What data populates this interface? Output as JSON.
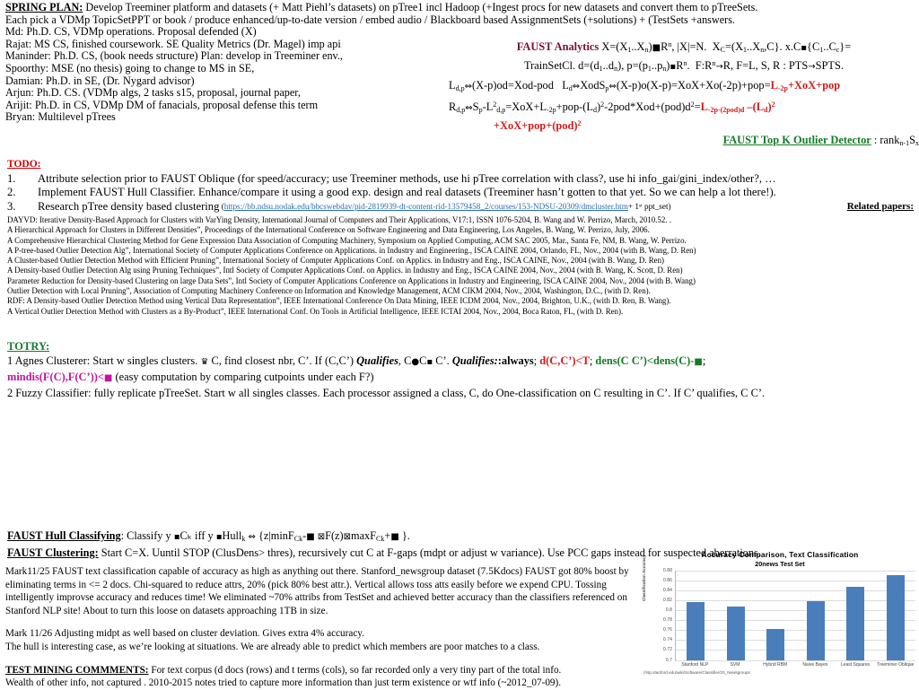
{
  "plan": {
    "heading": "SPRING PLAN:",
    "heading_rest": " Develop Treeminer platform and datasets (+ Matt Piehl’s datasets) on pTree1 incl Hadoop (+Ingest procs for new datasets and convert them to pTreeSets.",
    "lines": [
      "Each pick a VDMp TopicSetPPT or book / produce enhanced/up-to-date version / embed audio / Blackboard based AssignmentSets (+solutions) + (TestSets +answers.",
      "Md:  Ph.D. CS, VDMp operations.  Proposal defended (X)",
      "Rajat: MS CS, finished coursework. SE Quality Metrics (Dr. Magel) imp api",
      "Maninder: Ph.D. CS, (book needs structure)  Plan: develop in Treeminer env.,",
      "Spoorthy: MSE (no thesis) going to change to MS in SE,",
      "Damian: Ph.D. in SE, (Dr. Nygard advisor)",
      "Arjun:  Ph.D. CS. (VDMp algs, 2 tasks s15, proposal, journal paper,",
      "Arijit: Ph.D. in CS, VDMp DM of fanacials, proposal defense this term",
      "Bryan:  Multilevel pTrees"
    ]
  },
  "analytics": {
    "title": "FAUST Analytics",
    "line1_a": "X=(X",
    "line1_b": "..X",
    "line1_c": ")",
    "line1_d": "R",
    "line1_e": ", |X|=N.  X",
    "line1_f": "=(X",
    "line1_g": "..X",
    "line1_h": ",C}. x.C",
    "line1_i": "{C",
    "line1_j": "..C",
    "line1_k": "}=",
    "line2": "TrainSetCl. d=(d₁..dₙ), p=(p₁..pₙ)  Rⁿ.   F:Rⁿ  R, F=L, S, R : PTS  SPTS.",
    "line3_black": "Lₔ,ₚ  ⇔(X-p)od=Xod-pod   Lₔ ⇔XodSₚ ⇔(X-p)o(X-p)=XoX+Xo(-2p)+pop=",
    "line3_red": "L₋₂ₚ+XoX+pop",
    "line4_black": "Rₔ,ₚ ⇔Sₚ-L²ₔ,ₚ =XoX+L₋₂ₚ+pop-(Lₔ)²-2pod*Xod+(pod)d²=",
    "line4_red": "L₋₂ₚ₋₍₂ₚₒₔ₎ₔ –(Lₔ)²",
    "line5_red": "+XoX+pop+(pod)²",
    "topk_title": "FAUST Top K Outlier Detector",
    "topk_rest": " : rankₙ₋₁Sₓ"
  },
  "todo": {
    "header": "TODO:",
    "items": [
      {
        "num": "1.",
        "text": "Attribute selection prior to FAUST Oblique (for speed/accuracy; use Treeminer methods, use hi pTree correlation with class?,  use hi info_gai/gini_index/other?, …"
      },
      {
        "num": "2.",
        "text": "Implement FAUST Hull Classifier.  Enhance/compare it using a good exp. design and real datasets (Treeminer hasn’t gotten to that yet.  So we can help  a lot there!)."
      },
      {
        "num": "3.",
        "text": "Research pTree density based clustering"
      }
    ],
    "item3_link": "https://bb.ndsu.nodak.edu/bbcswebdav/pid-2819939-dt-content-rid-13579458_2/courses/153-NDSU-20309/dmcluster.htm",
    "item3_tail": " + 1ˢᵗ ppt_set)",
    "related_papers": "Related papers:"
  },
  "references": [
    "DAYVD: Iterative Density-Based Approach for Clusters with VarYing Density, International Journal of Computers and Their Applications, V17:1, ISSN 1076-5204, B. Wang and W. Perrizo, March, 2010.52. .",
    "A Hierarchical Approach for Clusters in Different Densities”, Proceedings of the International Conference on Software Engineering and Data Engineering, Los Angeles, B. Wang, W. Perrizo, July, 2006.",
    "A Comprehensive Hierarchical Clustering Method for Gene Expression Data Association of Computing Machinery, Symposium on Applied Computing, ACM SAC 2005, Mar., Santa Fe, NM, B. Wang, W. Perrizo.",
    "A P-tree-based Outlier Detection Alg”, International Society of Computer Applications Conference on Applications. in Industry and Engineering., ISCA CAINE 2004, Orlando, FL, Nov., 2004 (with B. Wang, D. Ren)",
    "A Cluster-based Outlier Detection Method with Efficient Pruning”, International Society of Computer Applications Conf. on Applics. in Industry and Eng., ISCA CAINE, Nov., 2004 (with B. Wang, D. Ren)",
    "A Density-based Outlier Detection Alg using Pruning Techniques”, Intl Society of Computer Applications Conf. on Applics. in Industry and Eng., ISCA CAINE 2004, Nov., 2004 (with B. Wang, K. Scott, D. Ren)",
    "Parameter Reduction for Density-based Clustering on large Data Sets”, Intl Society of Computer Applications Conference on Applications in Industry and Engineering, ISCA CAINE 2004, Nov., 2004 (with B. Wang)",
    "Outlier Detection with Local Pruning”, Association of Computing Machinery Conference on Information and Knowledge Management, ACM CIKM 2004, Nov., 2004, Washington, D.C., (with D. Ren).",
    "RDF: A Density-based Outlier Detection Method using Vertical Data Representation”, IEEE International Conference On Data Mining, IEEE ICDM 2004, Nov., 2004, Brighton, U.K., (with D. Ren, B. Wang).",
    "A Vertical Outlier Detection Method with Clusters as a By-Product”, IEEE International Conf. On Tools in Artificial Intelligence, IEEE ICTAI 2004, Nov., 2004, Boca Raton, FL, (with D. Ren)."
  ],
  "totry": {
    "header": "TOTRY:",
    "line1_a": "1 Agnes Clusterer: Start w singles clusters. ",
    "line1_b": " C, find closest nbr, C’.  If (C,C’) ",
    "line1_qualifies": "Qualifies",
    "line1_c": ", C",
    "line1_d": "C",
    "line1_e": " C’.  ",
    "line1_qualifies2": "Qualifies:",
    "line1_f": ":always",
    "line1_sep1": "; ",
    "line1_red": "d(C,C’)<T",
    "line1_sep2": "; ",
    "line1_green": "dens(C    C’)<dens(C)-",
    "line1_tail": ";",
    "line2_magenta": "min₝dis(F(C),F(C’))<",
    "line2_rest": " (easy computation by comparing cutpoints under each F?)",
    "line3": "2 Fuzzy Classifier: fully replicate pTreeSet.  Start w all singles classes.  Each processor assigned a class, C, do One-classification on C resulting in C’.  If C’ qualifies,  C    C’."
  },
  "hull": {
    "classify_hdr": "FAUST Hull Classifying",
    "classify_rest_a": ": Classify y ",
    "classify_rest_b": "Cₖ iff y ",
    "classify_rest_c": " Hullₖ ⇔  {z|minF",
    "classify_rest_d": "-  ≤ F(z) ≤ maxF",
    "classify_rest_e": "+  }.",
    "clustering_hdr": "FAUST Clustering:",
    "clustering_rest": "  Start C=X.  Uuntil STOP (ClusDens> thres), recursively cut C at F-gaps (mdpt or adjust w variance).  Use PCC gaps instead for suspected aberrations."
  },
  "marks": {
    "p1": "Mark11/25 FAUST text classification capable of accuracy as high as anything out there.  Stanford_newsgroup dataset (7.5Kdocs) FAUST got 80% boost by eliminating terms in <= 2 docs.  Chi-squared to reduce attrs, 20% (pick 80% best attr.).  Vertical allows toss atts easily before we expend CPU. Tossing intelligently improvse accuracy and reduces time!  We eliminated ~70% attribs from TestSet and achieved better accuracy than the classifiers referenced on Stanford NLP site!   About to turn this loose on datasets approaching 1TB in size.",
    "p2": "Mark 11/26 Adjusting midpt as well based on cluster deviation. Gives extra 4% accuracy.",
    "p3": "The hull is interesting case, as we’re looking at situations. We are already able to predict which members are poor matches to a class.",
    "test_hdr": "TEST MINING COMMMENTS:",
    "test_rest": " For text corpus (d docs (rows) and t terms (cols), so far recorded only a very tiny part of the total info.",
    "test_line2": "Wealth of other info, not captured .  2010-2015 notes tried to capture more information than just term existence or wtf info (~2012_07-09)."
  },
  "chart_data": {
    "type": "bar",
    "title": "Accuracy Comparison, Text Classification",
    "subtitle": "20news Test Set",
    "xlabel": "",
    "ylabel": "Classification Accuracy",
    "categories": [
      "Stanford NLP",
      "SVM",
      "Hybrid RBM",
      "Naive Bayes",
      "Least Squares",
      "Treeminer Oblique"
    ],
    "values": [
      0.817,
      0.807,
      0.762,
      0.818,
      0.847,
      0.87
    ],
    "yticks": [
      0.7,
      0.72,
      0.74,
      0.76,
      0.78,
      0.8,
      0.82,
      0.84,
      0.86,
      0.88
    ],
    "ylim": [
      0.7,
      0.88
    ],
    "grid": true,
    "legend": "none",
    "bar_color": "#4a7ebb",
    "source": "://nlp.stanford.edu/wiki/Software/Classifier/20_Newsgroups"
  }
}
